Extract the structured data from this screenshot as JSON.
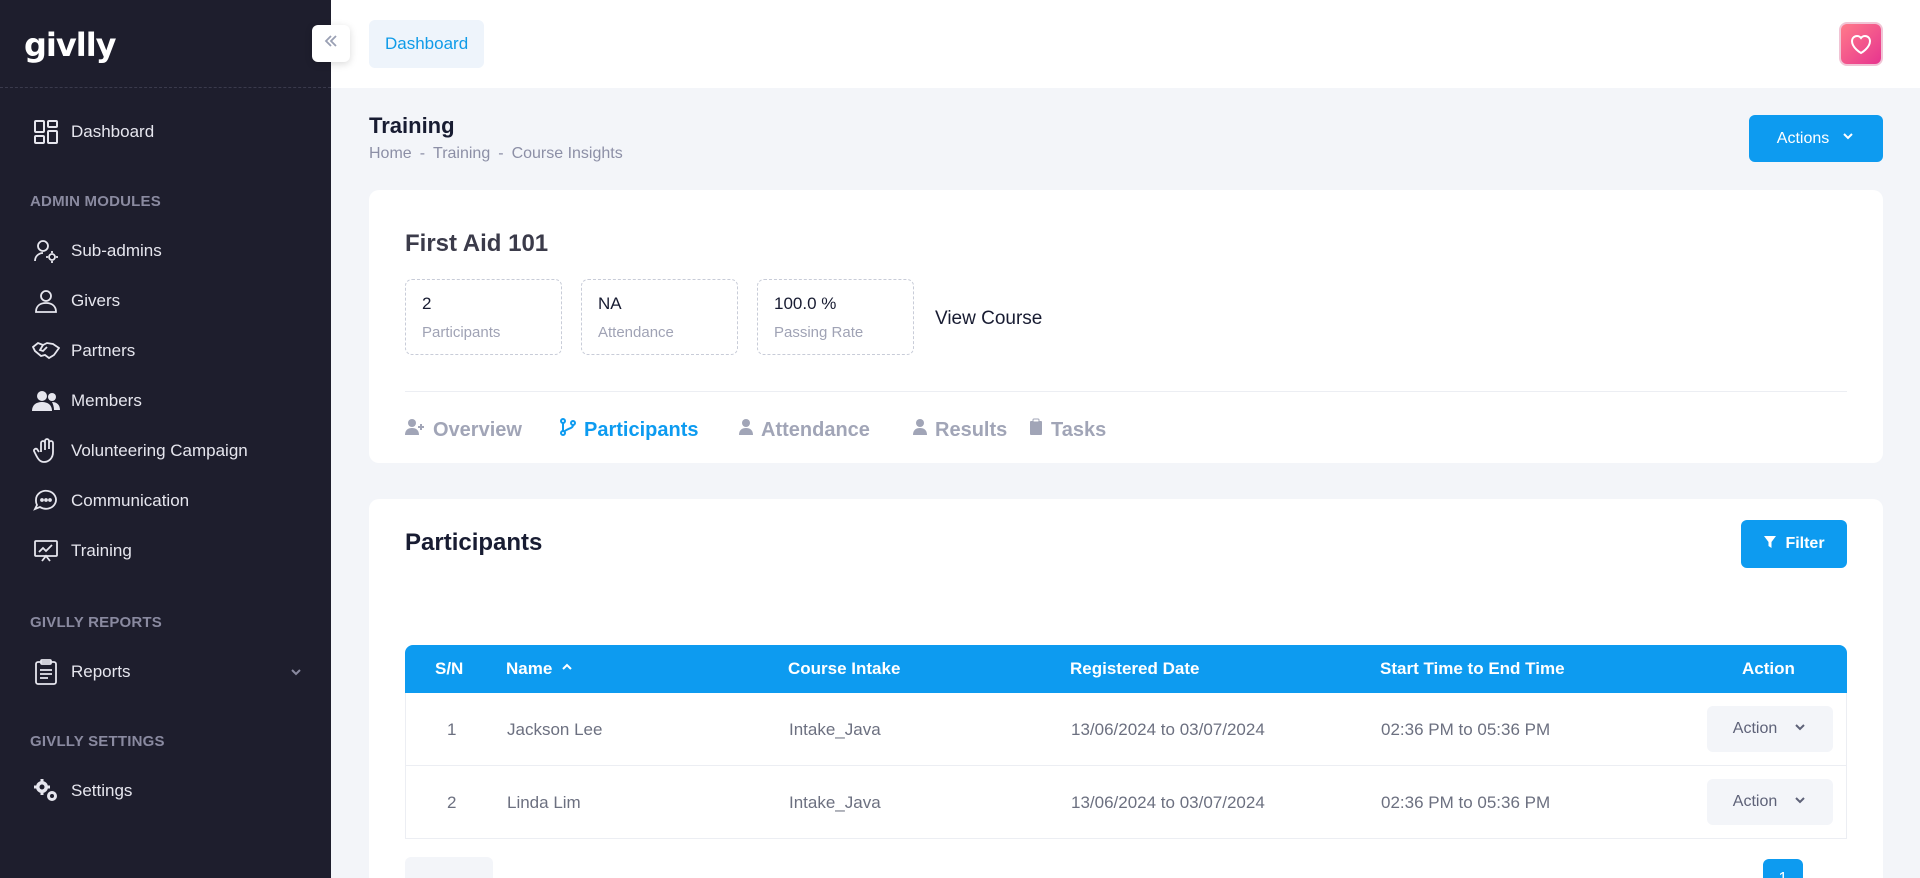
{
  "app": {
    "logo": "givlly",
    "colors": {
      "sidebar": "#1e1e2d",
      "accent": "#0d9bf0",
      "bg": "#f3f5f9"
    }
  },
  "sidebar": {
    "dashboard": {
      "label": "Dashboard",
      "icon": "dashboard-grid-icon"
    },
    "sections": {
      "admin": "ADMIN MODULES",
      "reports": "GIVLLY REPORTS",
      "settings": "GIVLLY SETTINGS"
    },
    "items": [
      {
        "label": "Sub-admins",
        "icon": "user-gear-icon"
      },
      {
        "label": "Givers",
        "icon": "user-icon"
      },
      {
        "label": "Partners",
        "icon": "handshake-icon"
      },
      {
        "label": "Members",
        "icon": "users-icon"
      },
      {
        "label": "Volunteering Campaign",
        "icon": "hand-icon"
      },
      {
        "label": "Communication",
        "icon": "chat-icon"
      },
      {
        "label": "Training",
        "icon": "presentation-icon"
      }
    ],
    "reports": {
      "label": "Reports",
      "icon": "clipboard-icon"
    },
    "settings": {
      "label": "Settings",
      "icon": "gears-icon"
    }
  },
  "topbar": {
    "dashboard_label": "Dashboard"
  },
  "page": {
    "title": "Training",
    "breadcrumb": [
      "Home",
      "-",
      "Training",
      "-",
      "Course Insights"
    ],
    "actions_label": "Actions"
  },
  "course": {
    "title": "First Aid 101",
    "stats": [
      {
        "value": "2",
        "label": "Participants"
      },
      {
        "value": "NA",
        "label": "Attendance"
      },
      {
        "value": "100.0 %",
        "label": "Passing Rate"
      }
    ],
    "view_course": "View Course",
    "tabs": [
      "Overview",
      "Participants",
      "Attendance",
      "Results",
      "Tasks"
    ],
    "active_tab": "Participants"
  },
  "participants": {
    "title": "Participants",
    "filter_label": "Filter",
    "columns": [
      "S/N",
      "Name",
      "Course Intake",
      "Registered Date",
      "Start Time to End Time",
      "Action"
    ],
    "rows": [
      {
        "sn": "1",
        "name": "Jackson Lee",
        "intake": "Intake_Java",
        "registered": "13/06/2024 to 03/07/2024",
        "time": "02:36 PM to 05:36 PM",
        "action": "Action"
      },
      {
        "sn": "2",
        "name": "Linda Lim",
        "intake": "Intake_Java",
        "registered": "13/06/2024 to 03/07/2024",
        "time": "02:36 PM to 05:36 PM",
        "action": "Action"
      }
    ],
    "page_number": "1"
  }
}
